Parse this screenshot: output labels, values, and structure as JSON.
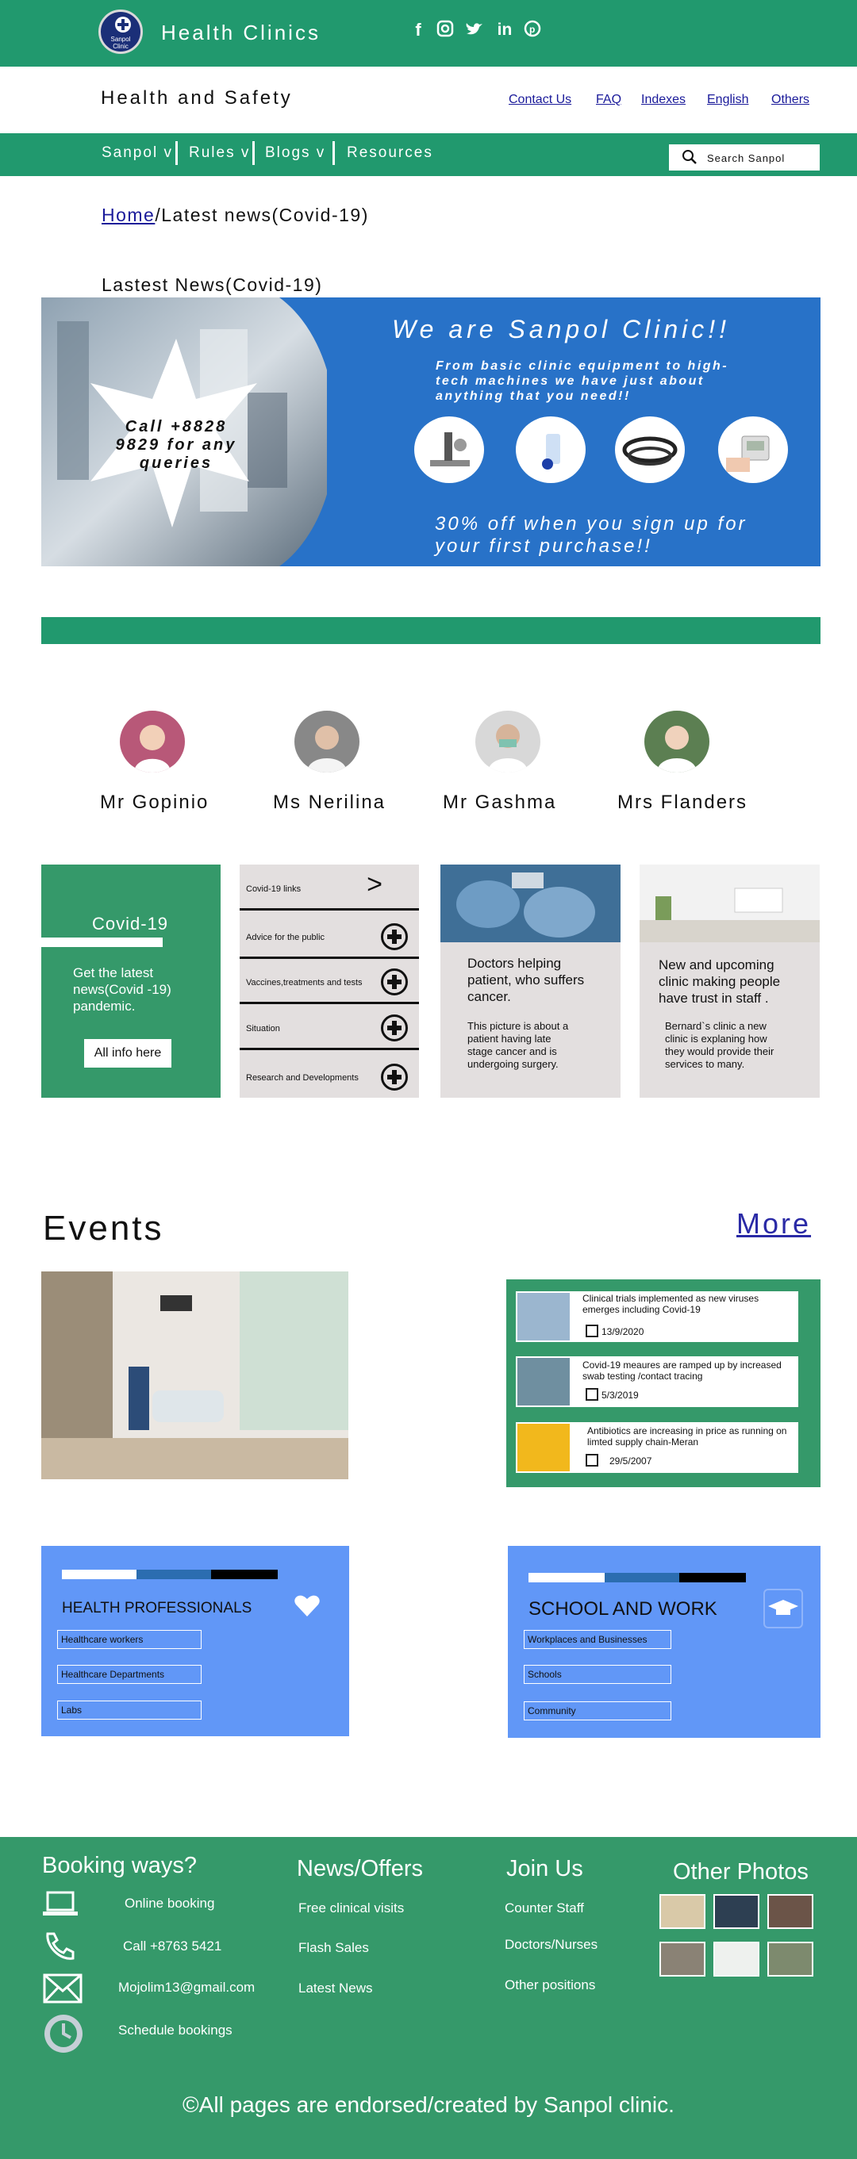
{
  "header": {
    "brand": "Health Clinics",
    "logo_text_1": "Sanpol",
    "logo_text_2": "Clinic",
    "social": [
      "facebook-icon",
      "instagram-icon",
      "twitter-icon",
      "linkedin-icon",
      "pinterest-icon"
    ]
  },
  "subheader": {
    "title": "Health and Safety",
    "links": [
      "Contact Us",
      "FAQ",
      "Indexes",
      "English",
      "Others"
    ]
  },
  "nav": {
    "items": [
      "Sanpol v",
      "Rules v",
      "Blogs v",
      "Resources"
    ],
    "search_placeholder": "Search Sanpol"
  },
  "breadcrumb": {
    "home": "Home",
    "current": "/Latest news(Covid-19)"
  },
  "section_title": "Lastest News(Covid-19)",
  "banner": {
    "star_text": "Call +8828 9829 for any queries",
    "heading": "We are Sanpol Clinic!!",
    "sub": "From basic clinic equipment to high-tech machines we have just about anything that you need!!",
    "offer": "30% off when you sign up for your first purchase!!"
  },
  "doctors": [
    {
      "name": "Mr Gopinio"
    },
    {
      "name": "Ms Nerilina"
    },
    {
      "name": "Mr Gashma"
    },
    {
      "name": "Mrs Flanders"
    }
  ],
  "covid_card": {
    "title": "Covid-19",
    "text": "Get the latest news(Covid -19) pandemic.",
    "button": "All info here"
  },
  "links_card": {
    "first": "Covid-19 links",
    "items": [
      "Advice for the public",
      "Vaccines,treatments and tests",
      "Situation",
      "Research and Developments"
    ]
  },
  "story1": {
    "title": "Doctors helping patient, who suffers cancer.",
    "text": "This picture is about a patient having late stage cancer and is undergoing surgery."
  },
  "story2": {
    "title": "New and upcoming clinic making people have trust in staff .",
    "text": "Bernard`s clinic a new clinic is explaning how they would provide their services to many."
  },
  "events": {
    "title": "Events",
    "more": "More",
    "items": [
      {
        "title": "Clinical trials implemented as new viruses emerges including Covid-19",
        "date": "13/9/2020"
      },
      {
        "title": "Covid-19 meaures are ramped up by increased swab testing /contact tracing",
        "date": "5/3/2019"
      },
      {
        "title": "Antibiotics are increasing in price as running on limted supply chain-Meran",
        "date": "29/5/2007"
      }
    ]
  },
  "health_box": {
    "title": "HEALTH PROFESSIONALS",
    "items": [
      "Healthcare workers",
      "Healthcare Departments",
      "Labs"
    ]
  },
  "school_box": {
    "title": "SCHOOL AND WORK",
    "items": [
      "Workplaces and Businesses",
      "Schools",
      "Community"
    ]
  },
  "footer": {
    "booking": {
      "title": "Booking ways?",
      "items": [
        "Online booking",
        "Call +8763 5421",
        "Mojolim13@gmail.com",
        "Schedule bookings"
      ]
    },
    "news": {
      "title": "News/Offers",
      "items": [
        "Free clinical visits",
        "Flash Sales",
        "Latest News"
      ]
    },
    "join": {
      "title": "Join Us",
      "items": [
        "Counter Staff",
        "Doctors/Nurses",
        "Other positions"
      ]
    },
    "photos": {
      "title": "Other Photos"
    },
    "copyright": "©All pages are endorsed/created by Sanpol clinic."
  },
  "colors": {
    "green": "#21996e",
    "banner_blue": "#2872c8",
    "box_blue": "#6197f7",
    "footer_green": "#35996a"
  }
}
